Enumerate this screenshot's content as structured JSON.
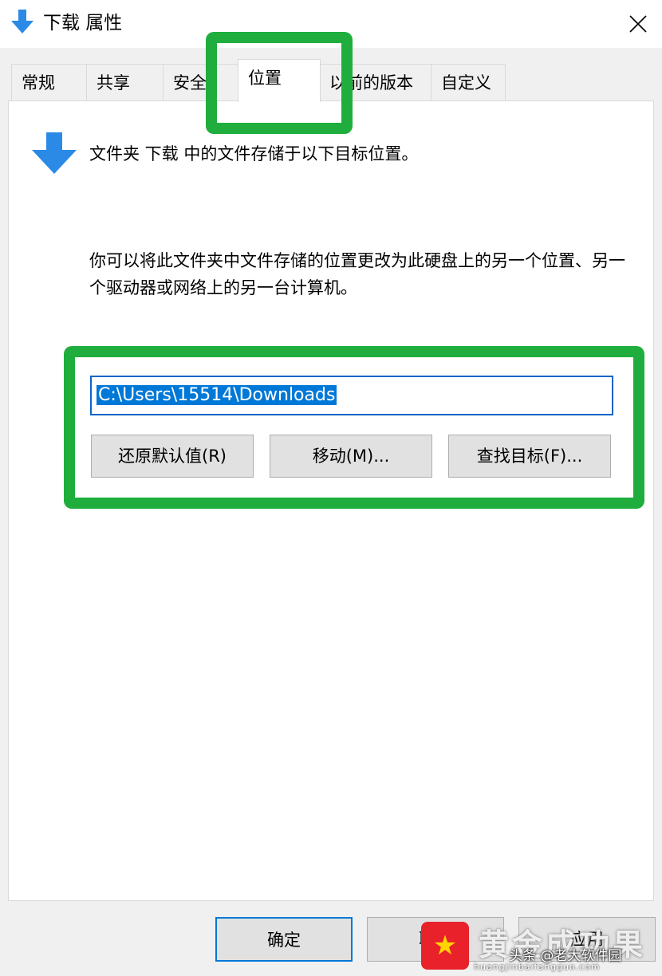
{
  "window": {
    "title": "下载 属性",
    "close_icon": "close-icon"
  },
  "tabs": [
    {
      "label": "常规",
      "active": false
    },
    {
      "label": "共享",
      "active": false
    },
    {
      "label": "安全",
      "active": false
    },
    {
      "label": "位置",
      "active": true
    },
    {
      "label": "以前的版本",
      "active": false
    },
    {
      "label": "自定义",
      "active": false
    }
  ],
  "location": {
    "heading": "文件夹 下载 中的文件存储于以下目标位置。",
    "description": "你可以将此文件夹中文件存储的位置更改为此硬盘上的另一个位置、另一个驱动器或网络上的另一台计算机。",
    "path_value": "C:\\Users\\15514\\Downloads",
    "restore_button": "还原默认值(R)",
    "move_button": "移动(M)...",
    "find_button": "查找目标(F)..."
  },
  "footer": {
    "ok_button": "确定",
    "cancel_button": "取消",
    "apply_button": "应用"
  },
  "watermark": {
    "brand": "黄金成功果",
    "label": "头条 @老大软件园",
    "url": "huangjinbaifangguo.com"
  },
  "colors": {
    "highlight_green": "#1fae3d",
    "selection_blue": "#0078d7",
    "folder_blue": "#2b8ae6"
  }
}
